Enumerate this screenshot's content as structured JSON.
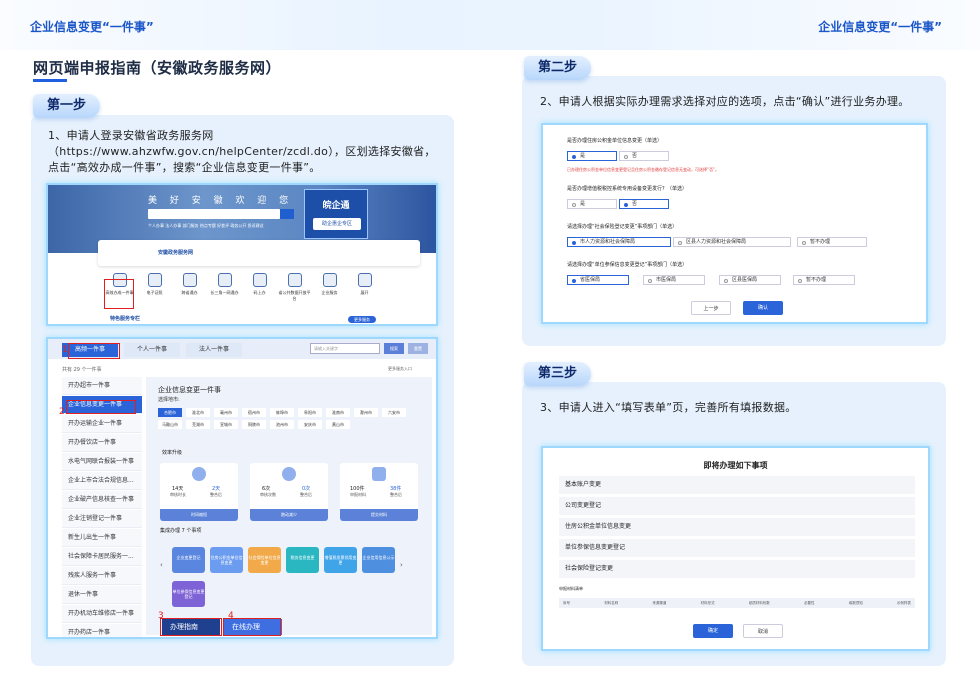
{
  "header": {
    "left": "企业信息变更“一件事”",
    "right": "企业信息变更“一件事”"
  },
  "title": "网页端申报指南（安徽政务服务网）",
  "step1": {
    "tag": "第一步",
    "text": "1、申请人登录安徽省政务服务网（https://www.ahzwfw.gov.cn/helpCenter/zcdl.do），区划选择安徽省，点击“高效办成一件事”，搜索“企业信息变更一件事”。"
  },
  "step2": {
    "tag": "第二步",
    "text": "2、申请人根据实际办理需求选择对应的选项，点击“确认”进行业务办理。"
  },
  "step3": {
    "tag": "第三步",
    "text": "3、申请人进入“填写表单”页，完善所有填报数据。"
  },
  "shot1": {
    "banner_title": "美 好 安 徽 欢 迎 您",
    "search_btn": "搜索",
    "links": "个人办事 法人办事 部门服务 热点专题 好差评 政务公开 投诉建议",
    "wqt_title": "皖企通",
    "wqt_sub": "助企惠企专区",
    "notice_brand": "安徽政务服务网",
    "icons": [
      "高效办成一件事",
      "电子证照",
      "跨省通办",
      "长三角一网通办",
      "码上办",
      "省公共数据开放平台",
      "企业服务",
      "展开"
    ],
    "featured": "特色服务专栏",
    "more": "更多服务"
  },
  "shot2": {
    "tabs": [
      "高频一件事",
      "个人一件事",
      "法人一件事"
    ],
    "search_placeholder": "请输入关键字",
    "search_btn": "搜索",
    "reset_btn": "重置",
    "count": "共有 29 个一件事",
    "all_link": "更多服务入口",
    "list": [
      "开办超市一件事",
      "企业信息变更一件事",
      "开办运输企业一件事",
      "开办餐饮店一件事",
      "水电气网联合报装一件事",
      "企业上市合法合规信息...",
      "企业破产信息核查一件事",
      "企业注销登记一件事",
      "新生儿出生一件事",
      "社会保障卡居民服务一...",
      "残疾人服务一件事",
      "退休一件事",
      "开办机动车维修店一件事",
      "开办药店一件事"
    ],
    "pane_title": "企业信息变更一件事",
    "region_label": "选择地市:",
    "cities": [
      "合肥市",
      "淮北市",
      "亳州市",
      "宿州市",
      "蚌埠市",
      "阜阳市",
      "淮南市",
      "滁州市",
      "六安市",
      "马鞍山市",
      "芜湖市",
      "宣城市",
      "铜陵市",
      "池州市",
      "安庆市",
      "黄山市"
    ],
    "effect_label": "效率升级",
    "stats": [
      {
        "a": "14天",
        "al": "审核时长",
        "b": "2天",
        "bl": "整合后",
        "foot": "时间缩短"
      },
      {
        "a": "6次",
        "al": "审核次数",
        "b": "0次",
        "bl": "整合后",
        "foot": "跑动减少"
      },
      {
        "a": "100件",
        "al": "申报材料",
        "b": "38件",
        "bl": "整合后",
        "foot": "提交材料"
      }
    ],
    "matters_label": "集成办理 7 个事项",
    "tiles": [
      "企业变更登记",
      "住房公积金单位信息变更",
      "社会保险单位信息变更",
      "税务信息变更",
      "增值税发票领用变更",
      "企业信用信息公示",
      "单位参保信息变更登记"
    ],
    "guide_btn": "办理指南",
    "online_btn": "在线办理",
    "markers": [
      "1",
      "2",
      "3",
      "4"
    ]
  },
  "shot3": {
    "q1": "是否办理住房公积金单位信息变更（单选）",
    "q1_opts": [
      "是",
      "否"
    ],
    "warn": "已办理住房公积金单位信息变更登记且住房公积金缴存登记信息无变动，可选择“否”。",
    "q2": "是否办理增值税税控系统专用设备变更发行？（单选）",
    "q2_opts": [
      "是",
      "否"
    ],
    "q3": "请选择办理“社会保险登记变更”事项部门（单选）",
    "q3_opts": [
      "市人力资源和社会保障局",
      "区县人力资源和社会保障局",
      "暂不办理"
    ],
    "q4": "请选择办理“单位参保信息变更登记”事项部门（单选）",
    "q4_opts": [
      "省医保局",
      "市医保局",
      "区县医保局",
      "暂不办理"
    ],
    "prev": "上一步",
    "confirm": "确认"
  },
  "shot4": {
    "title": "即将办理如下事项",
    "rows": [
      "基本账户变更",
      "公司变更登记",
      "住房公积金单位信息变更",
      "单位参保信息变更登记",
      "社会保险登记变更"
    ],
    "material_label": "申报材料清单",
    "cols": [
      "序号",
      "材料名称",
      "来源渠道",
      "材料形式",
      "纸质材料份数",
      "必要性",
      "填报须知",
      "示例样表"
    ],
    "ok": "确定",
    "cancel": "取消"
  },
  "colors": {
    "accent": "#1f5fe0",
    "panel": "#e6f1fd",
    "red": "#e02020"
  }
}
